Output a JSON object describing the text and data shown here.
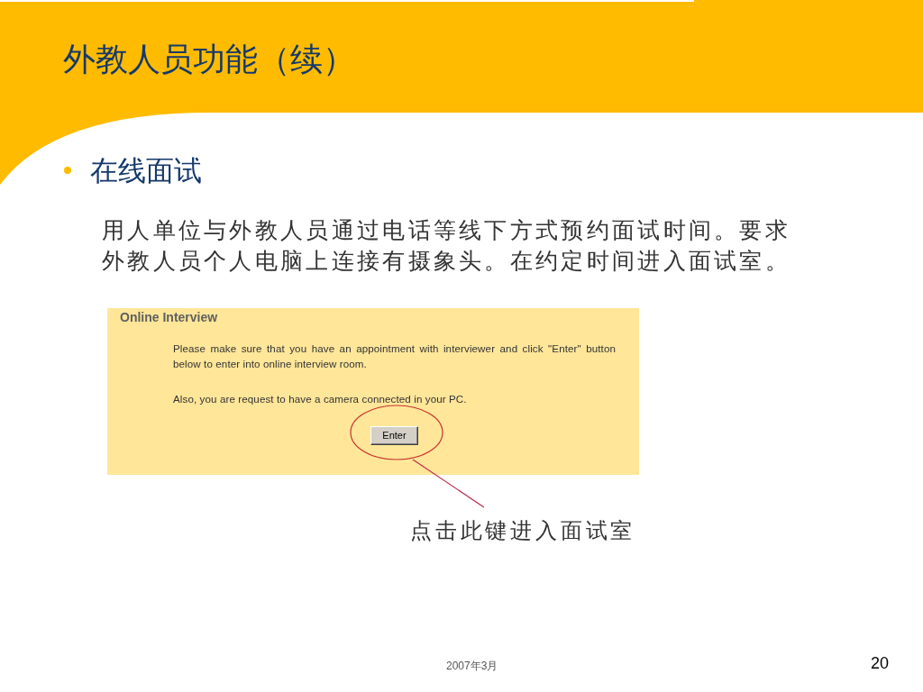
{
  "slide": {
    "title": "外教人员功能（续）",
    "bullet": "在线面试",
    "description": "用人单位与外教人员通过电话等线下方式预约面试时间。要求外教人员个人电脑上连接有摄象头。在约定时间进入面试室。",
    "embedded_screen": {
      "heading": "Online Interview",
      "paragraphs": [
        "Please make sure that you have an appointment with interviewer and click \"Enter\" button below to enter into online interview room.",
        "Also, you are request to have a camera connected in your PC."
      ],
      "button": "Enter"
    },
    "callout": "点击此键进入面试室",
    "footer": {
      "date": "2007年3月",
      "page_number": "20"
    }
  }
}
